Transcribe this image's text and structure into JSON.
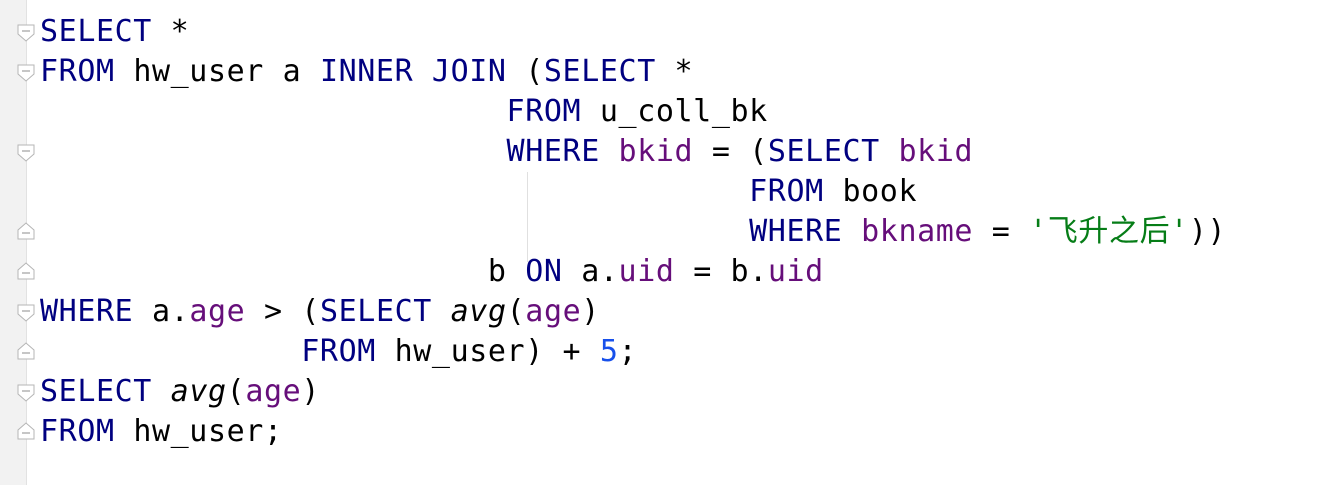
{
  "editor": {
    "language": "SQL",
    "colors": {
      "keyword": "#000080",
      "column": "#660e7a",
      "string": "#067d17",
      "number": "#1750eb",
      "text": "#000000",
      "gutter": "#f2f2f2"
    },
    "lines": [
      {
        "tokens": [
          {
            "t": "kw",
            "v": "SELECT"
          },
          {
            "t": "plain",
            "v": " "
          },
          {
            "t": "fn",
            "v": "*"
          }
        ]
      },
      {
        "tokens": [
          {
            "t": "kw",
            "v": "FROM"
          },
          {
            "t": "plain",
            "v": " hw_user a "
          },
          {
            "t": "kw",
            "v": "INNER JOIN"
          },
          {
            "t": "plain",
            "v": " ("
          },
          {
            "t": "kw",
            "v": "SELECT"
          },
          {
            "t": "plain",
            "v": " "
          },
          {
            "t": "fn",
            "v": "*"
          }
        ]
      },
      {
        "tokens": [
          {
            "t": "plain",
            "v": "                         "
          },
          {
            "t": "kw",
            "v": "FROM"
          },
          {
            "t": "plain",
            "v": " u_coll_bk"
          }
        ]
      },
      {
        "tokens": [
          {
            "t": "plain",
            "v": "                         "
          },
          {
            "t": "kw",
            "v": "WHERE"
          },
          {
            "t": "plain",
            "v": " "
          },
          {
            "t": "col",
            "v": "bkid"
          },
          {
            "t": "plain",
            "v": " = ("
          },
          {
            "t": "kw",
            "v": "SELECT"
          },
          {
            "t": "plain",
            "v": " "
          },
          {
            "t": "col",
            "v": "bkid"
          }
        ]
      },
      {
        "tokens": [
          {
            "t": "plain",
            "v": "                                      "
          },
          {
            "t": "kw",
            "v": "FROM"
          },
          {
            "t": "plain",
            "v": " book"
          }
        ]
      },
      {
        "tokens": [
          {
            "t": "plain",
            "v": "                                      "
          },
          {
            "t": "kw",
            "v": "WHERE"
          },
          {
            "t": "plain",
            "v": " "
          },
          {
            "t": "col",
            "v": "bkname"
          },
          {
            "t": "plain",
            "v": " = "
          },
          {
            "t": "str",
            "v": "'飞升之后'"
          },
          {
            "t": "plain",
            "v": "))"
          }
        ]
      },
      {
        "tokens": [
          {
            "t": "plain",
            "v": "                        b "
          },
          {
            "t": "kw",
            "v": "ON"
          },
          {
            "t": "plain",
            "v": " a."
          },
          {
            "t": "col",
            "v": "uid"
          },
          {
            "t": "plain",
            "v": " = b."
          },
          {
            "t": "col",
            "v": "uid"
          }
        ]
      },
      {
        "tokens": [
          {
            "t": "kw",
            "v": "WHERE"
          },
          {
            "t": "plain",
            "v": " a."
          },
          {
            "t": "col",
            "v": "age"
          },
          {
            "t": "plain",
            "v": " > ("
          },
          {
            "t": "kw",
            "v": "SELECT"
          },
          {
            "t": "plain",
            "v": " "
          },
          {
            "t": "fn",
            "v": "avg"
          },
          {
            "t": "plain",
            "v": "("
          },
          {
            "t": "col",
            "v": "age"
          },
          {
            "t": "plain",
            "v": ")"
          }
        ]
      },
      {
        "tokens": [
          {
            "t": "plain",
            "v": "              "
          },
          {
            "t": "kw",
            "v": "FROM"
          },
          {
            "t": "plain",
            "v": " hw_user) + "
          },
          {
            "t": "num",
            "v": "5"
          },
          {
            "t": "plain",
            "v": ";"
          }
        ]
      },
      {
        "tokens": [
          {
            "t": "kw",
            "v": "SELECT"
          },
          {
            "t": "plain",
            "v": " "
          },
          {
            "t": "fn",
            "v": "avg"
          },
          {
            "t": "plain",
            "v": "("
          },
          {
            "t": "col",
            "v": "age"
          },
          {
            "t": "plain",
            "v": ")"
          }
        ]
      },
      {
        "tokens": [
          {
            "t": "kw",
            "v": "FROM"
          },
          {
            "t": "plain",
            "v": " hw_user;"
          }
        ]
      }
    ]
  }
}
